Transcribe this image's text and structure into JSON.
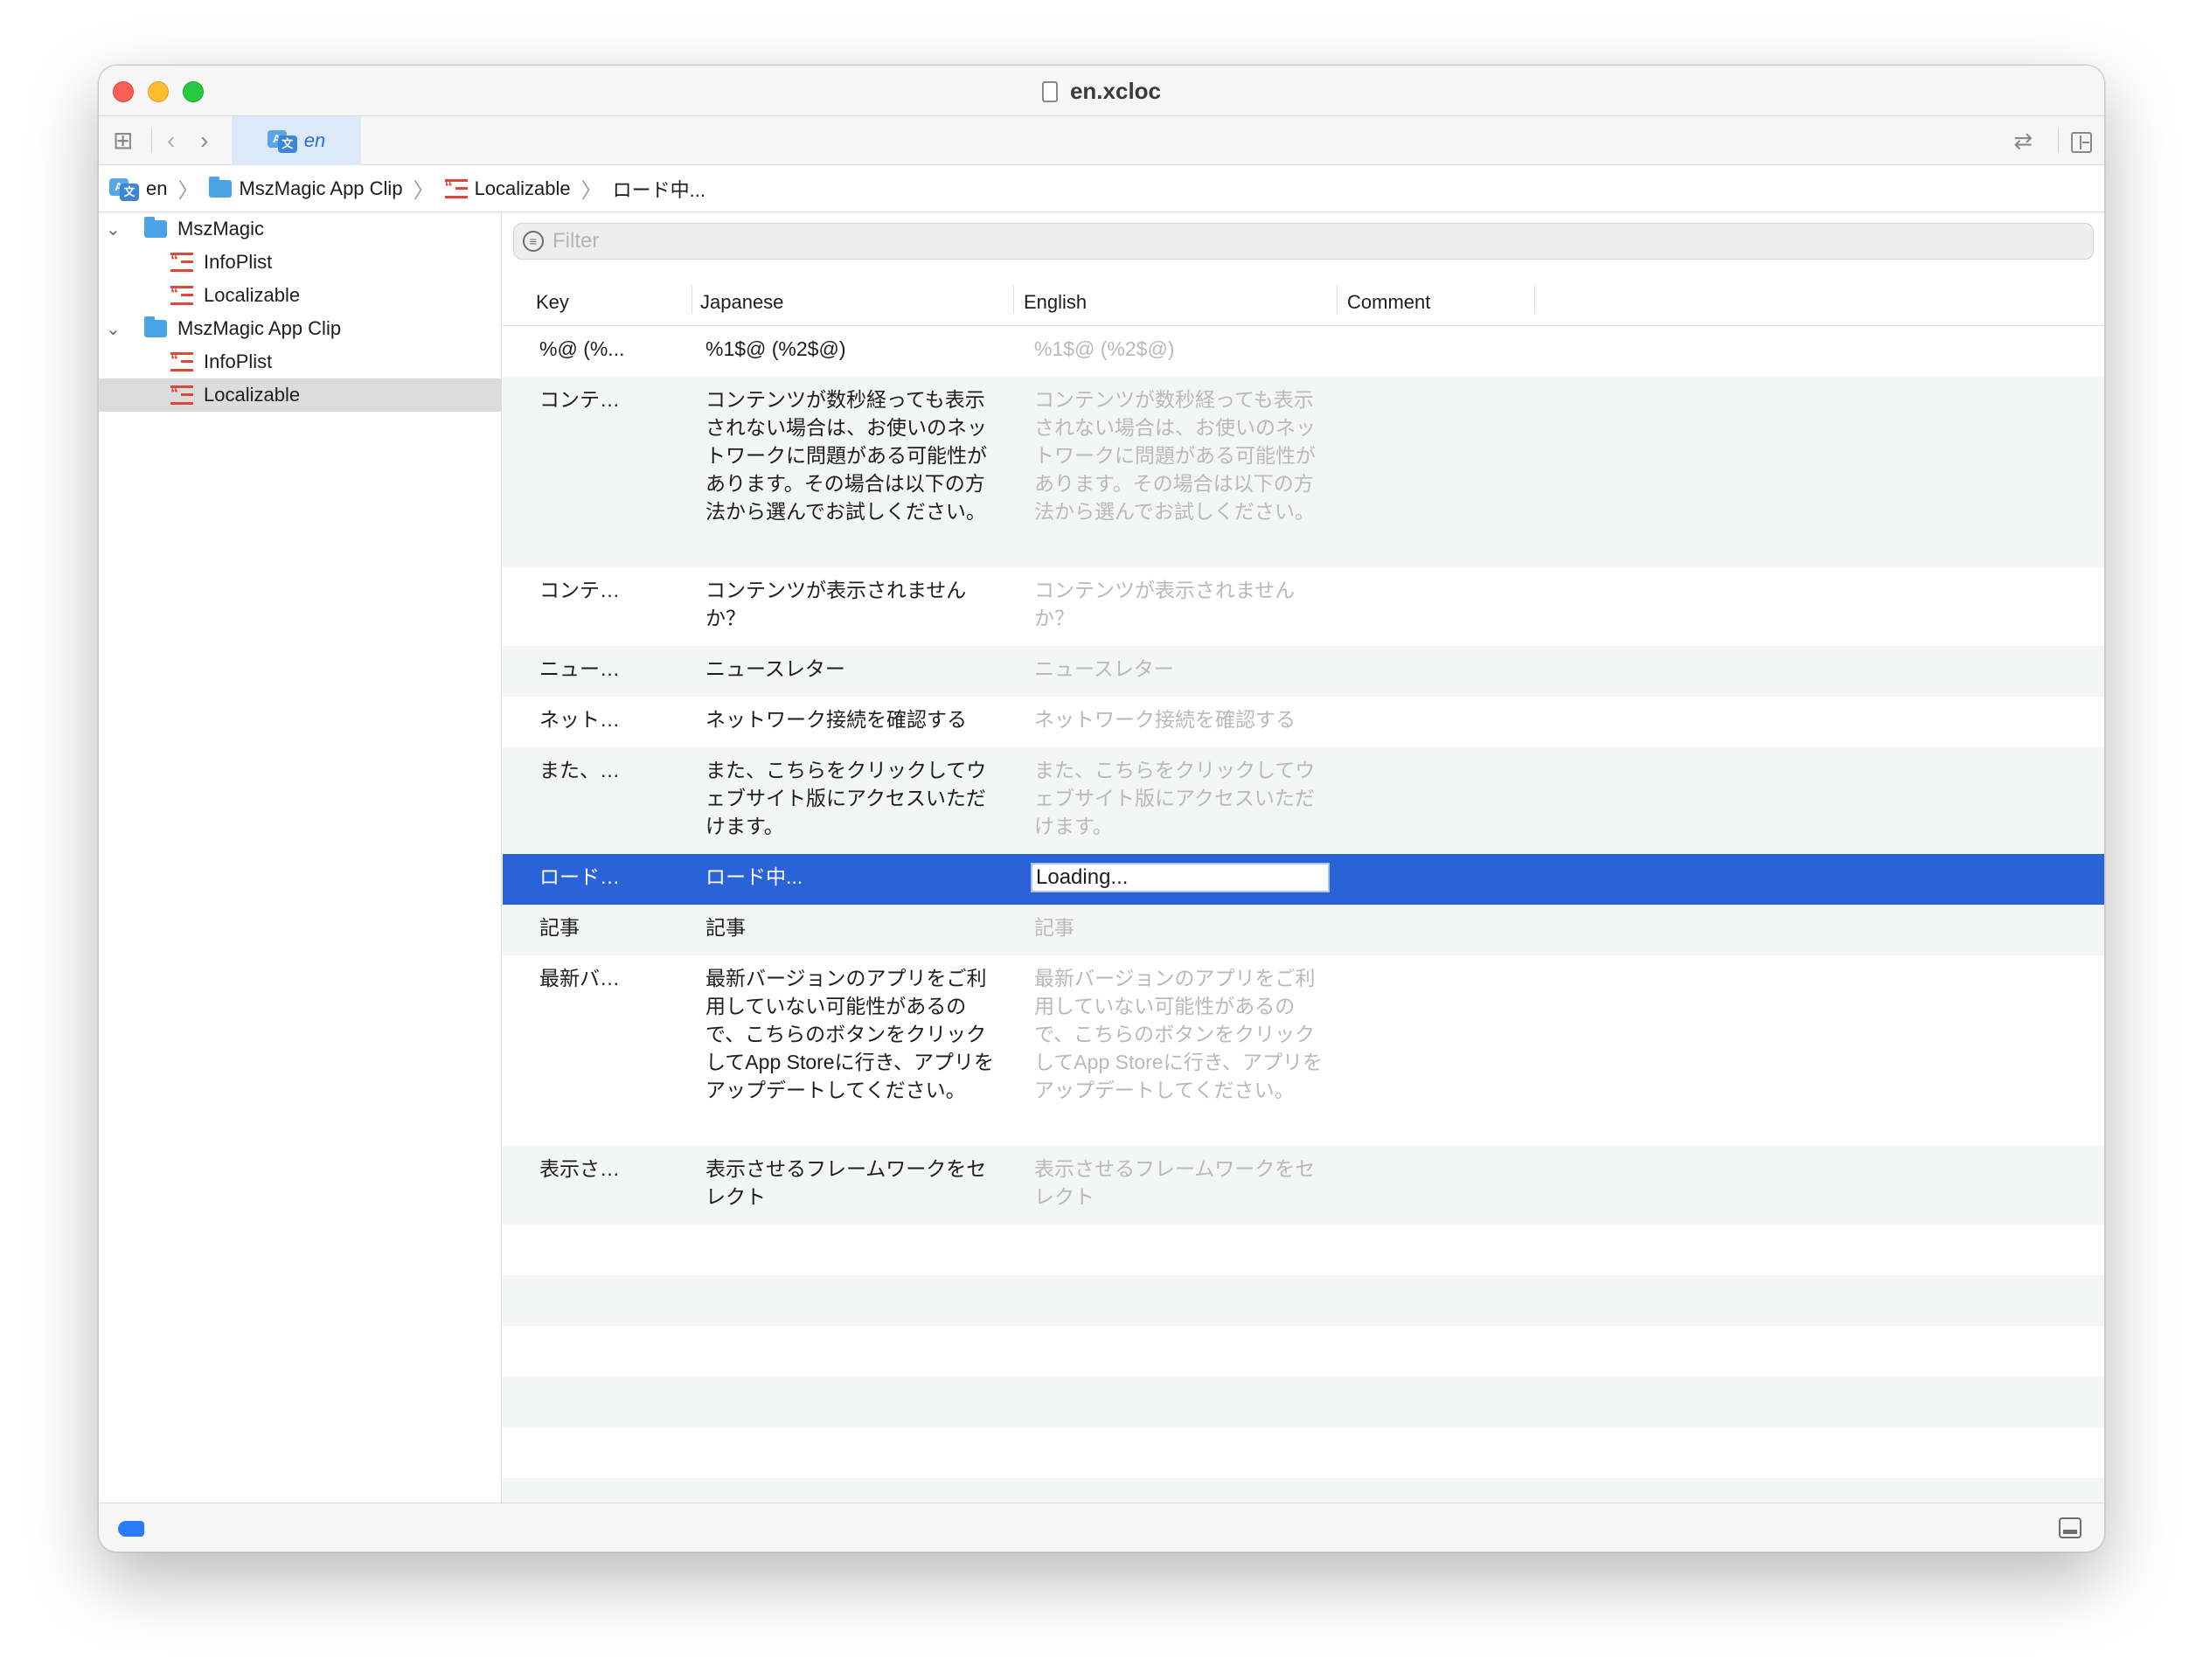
{
  "window": {
    "title": "en.xcloc"
  },
  "tabbar": {
    "grid_icon": "grid-icon",
    "back_icon": "chevron-left-icon",
    "forward_icon": "chevron-right-icon",
    "active_tab": "en",
    "swap_icon": "swap-arrows-icon",
    "inspector_icon": "add-editor-icon"
  },
  "breadcrumb": {
    "items": [
      "en",
      "MszMagic App Clip",
      "Localizable",
      "ロード中..."
    ]
  },
  "sidebar": {
    "groups": [
      {
        "label": "MszMagic",
        "items": [
          "InfoPlist",
          "Localizable"
        ]
      },
      {
        "label": "MszMagic App Clip",
        "items": [
          "InfoPlist",
          "Localizable"
        ]
      }
    ]
  },
  "filter": {
    "placeholder": "Filter"
  },
  "table": {
    "headers": [
      "Key",
      "Japanese",
      "English",
      "Comment"
    ],
    "rows": [
      {
        "key": "%@ (%...",
        "jp": "%1$@ (%2$@)",
        "en": "%1$@ (%2$@)"
      },
      {
        "key": "コンテ…",
        "jp": "コンテンツが数秒経っても表示されない場合は、お使いのネットワークに問題がある可能性があります。その場合は以下の方法から選んでお試しください。",
        "en": "コンテンツが数秒経っても表示されない場合は、お使いのネットワークに問題がある可能性があります。その場合は以下の方法から選んでお試しください。"
      },
      {
        "key": "コンテ…",
        "jp": "コンテンツが表示されませんか？",
        "en": "コンテンツが表示されませんか？"
      },
      {
        "key": "ニュー…",
        "jp": "ニュースレター",
        "en": "ニュースレター"
      },
      {
        "key": "ネット…",
        "jp": "ネットワーク接続を確認する",
        "en": "ネットワーク接続を確認する"
      },
      {
        "key": "また、…",
        "jp": "また、こちらをクリックしてウェブサイト版にアクセスいただけます。",
        "en": "また、こちらをクリックしてウェブサイト版にアクセスいただけます。"
      },
      {
        "key": "ロード…",
        "jp": "ロード中...",
        "en": "Loading..."
      },
      {
        "key": "記事",
        "jp": "記事",
        "en": "記事"
      },
      {
        "key": "最新バ…",
        "jp": "最新バージョンのアプリをご利用していない可能性があるので、こちらのボタンをクリックしてApp Storeに行き、アプリをアップデートしてください。",
        "en": "最新バージョンのアプリをご利用していない可能性があるので、こちらのボタンをクリックしてApp Storeに行き、アプリをアップデートしてください。"
      },
      {
        "key": "表示さ…",
        "jp": "表示させるフレームワークをセレクト",
        "en": "表示させるフレームワークをセレクト"
      }
    ]
  },
  "colors": {
    "selection": "#2a62d8",
    "accent": "#2a7bf4",
    "strings_icon": "#e0473b",
    "folder": "#4aa3e6"
  }
}
